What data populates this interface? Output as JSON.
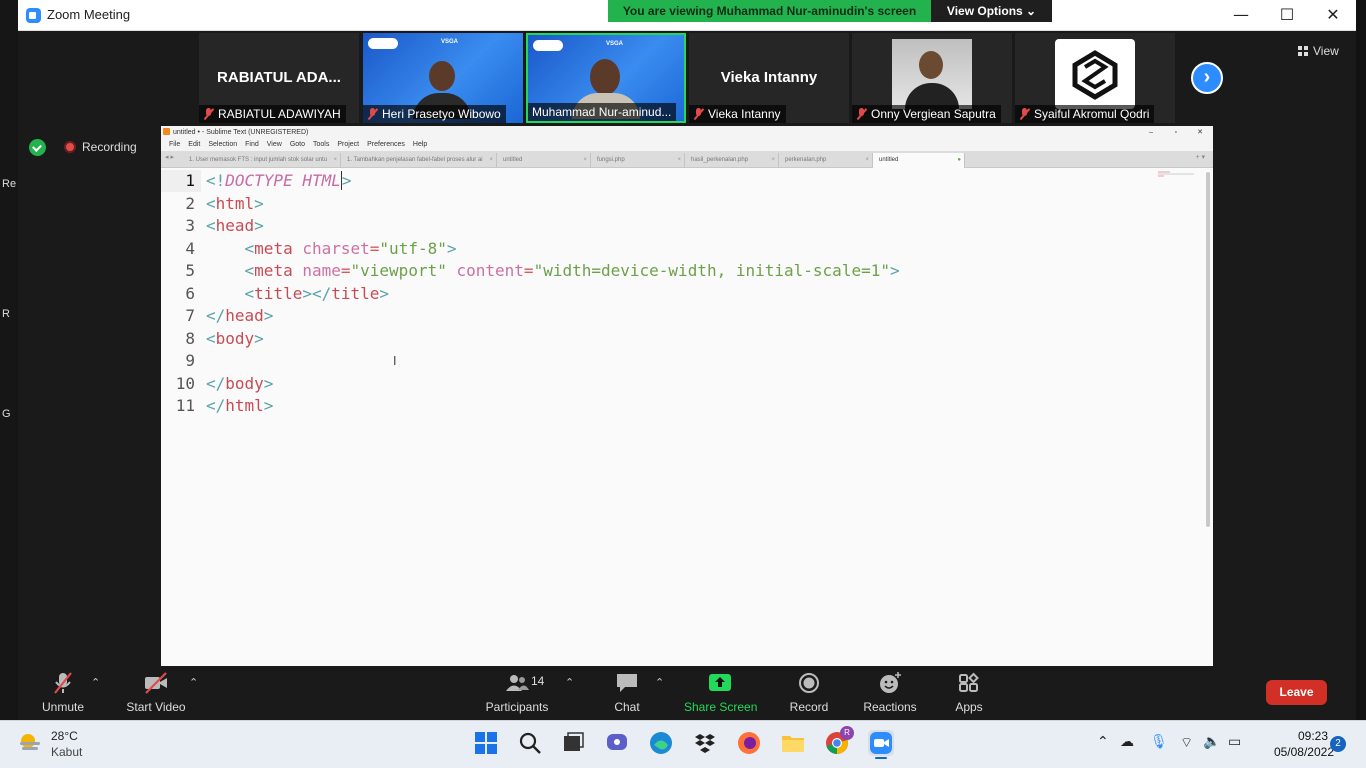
{
  "window": {
    "title": "Zoom Meeting",
    "minimize": "—",
    "maximize": "☐",
    "close": "✕"
  },
  "share_banner": {
    "text": "You are viewing Muhammad Nur-aminudin's screen",
    "view_options": "View Options ⌄"
  },
  "gallery": {
    "tiles": [
      {
        "name": "RABIATUL ADAWIYAH",
        "big_name": "RABIATUL ADA...",
        "muted": true,
        "video": false
      },
      {
        "name": "Heri Prasetyo Wibowo",
        "muted": true,
        "video": true
      },
      {
        "name": "Muhammad Nur-aminud...",
        "muted": false,
        "video": true,
        "active_speaker": true
      },
      {
        "name": "Vieka Intanny",
        "big_name": "Vieka Intanny",
        "muted": true,
        "video": false
      },
      {
        "name": "Onny Vergiean Saputra",
        "muted": true,
        "video": true
      },
      {
        "name": "Syaiful Akromul Qodri",
        "muted": true,
        "video": false,
        "avatar_logo": true
      }
    ],
    "video_banner_text": "VSGA",
    "next_icon": "chevron-right-icon",
    "view_label": "View"
  },
  "status": {
    "recording_label": "Recording",
    "desktop_fragments": [
      "Re",
      "R",
      "G"
    ]
  },
  "sublime": {
    "title": "untitled • - Sublime Text (UNREGISTERED)",
    "menu": [
      "File",
      "Edit",
      "Selection",
      "Find",
      "View",
      "Goto",
      "Tools",
      "Project",
      "Preferences",
      "Help"
    ],
    "tabs": [
      "1. User memasok FTS : input jumlah stok solar untu",
      "1. Tambahkan penjelasan fabel-fabel proses alur ai",
      "untitled",
      "fungsi.php",
      "hasil_perkenalan.php",
      "perkenalan.php",
      "untitled"
    ],
    "line_numbers": [
      "1",
      "2",
      "3",
      "4",
      "5",
      "6",
      "7",
      "8",
      "9",
      "10",
      "11"
    ],
    "code": {
      "l1": {
        "open": "<!",
        "doctype": "DOCTYPE HTML",
        "close": ">"
      },
      "l2": {
        "open": "<",
        "tag": "html",
        "close": ">"
      },
      "l3": {
        "open": "<",
        "tag": "head",
        "close": ">"
      },
      "l4": {
        "indent": "    ",
        "open": "<",
        "tag": "meta",
        "sp": " ",
        "attr": "charset",
        "eq": "=",
        "value": "\"utf-8\"",
        "close": ">"
      },
      "l5": {
        "indent": "    ",
        "open": "<",
        "tag": "meta",
        "sp1": " ",
        "attr1": "name",
        "eq1": "=",
        "value1": "\"viewport\"",
        "sp2": " ",
        "attr2": "content",
        "eq2": "=",
        "value2": "\"width=device-width, initial-scale=1\"",
        "close": ">"
      },
      "l6": {
        "indent": "    ",
        "open": "<",
        "tag": "title",
        "mid": "></",
        "tag2": "title",
        "close": ">"
      },
      "l7": {
        "open": "</",
        "tag": "head",
        "close": ">"
      },
      "l8": {
        "open": "<",
        "tag": "body",
        "close": ">"
      },
      "l9": "",
      "l10": {
        "open": "</",
        "tag": "body",
        "close": ">"
      },
      "l11": {
        "open": "</",
        "tag": "html",
        "close": ">"
      }
    }
  },
  "toolbar": {
    "unmute": "Unmute",
    "start_video": "Start Video",
    "participants": "Participants",
    "participants_count": "14",
    "chat": "Chat",
    "share_screen": "Share Screen",
    "record": "Record",
    "reactions": "Reactions",
    "apps": "Apps",
    "leave": "Leave"
  },
  "taskbar": {
    "weather_temp": "28°C",
    "weather_desc": "Kabut",
    "clock": "09:23",
    "date": "05/08/2022",
    "notifications": "2",
    "chrome_badge": "R"
  },
  "colors": {
    "accent": "#2d8cff",
    "banner_green": "#23b34e",
    "leave_red": "#d22f26",
    "share_green": "#23d959"
  }
}
